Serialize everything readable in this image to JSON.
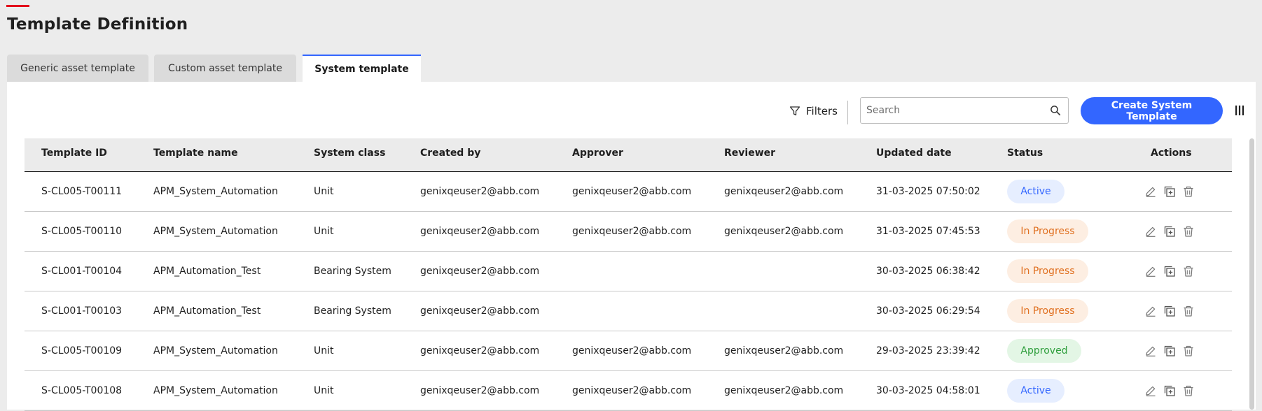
{
  "page": {
    "title": "Template Definition"
  },
  "tabs": [
    {
      "label": "Generic asset template",
      "active": false
    },
    {
      "label": "Custom asset template",
      "active": false
    },
    {
      "label": "System template",
      "active": true
    }
  ],
  "toolbar": {
    "filters_label": "Filters",
    "search_placeholder": "Search",
    "create_label": "Create System Template"
  },
  "table": {
    "headers": {
      "id": "Template ID",
      "name": "Template name",
      "system_class": "System class",
      "created_by": "Created by",
      "approver": "Approver",
      "reviewer": "Reviewer",
      "updated": "Updated date",
      "status": "Status",
      "actions": "Actions"
    },
    "rows": [
      {
        "id": "S-CL005-T00111",
        "name": "APM_System_Automation",
        "system_class": "Unit",
        "created_by": "genixqeuser2@abb.com",
        "approver": "genixqeuser2@abb.com",
        "reviewer": "genixqeuser2@abb.com",
        "updated": "31-03-2025 07:50:02",
        "status": "Active"
      },
      {
        "id": "S-CL005-T00110",
        "name": "APM_System_Automation",
        "system_class": "Unit",
        "created_by": "genixqeuser2@abb.com",
        "approver": "genixqeuser2@abb.com",
        "reviewer": "genixqeuser2@abb.com",
        "updated": "31-03-2025 07:45:53",
        "status": "In Progress"
      },
      {
        "id": "S-CL001-T00104",
        "name": "APM_Automation_Test",
        "system_class": "Bearing System",
        "created_by": "genixqeuser2@abb.com",
        "approver": "",
        "reviewer": "",
        "updated": "30-03-2025 06:38:42",
        "status": "In Progress"
      },
      {
        "id": "S-CL001-T00103",
        "name": "APM_Automation_Test",
        "system_class": "Bearing System",
        "created_by": "genixqeuser2@abb.com",
        "approver": "",
        "reviewer": "",
        "updated": "30-03-2025 06:29:54",
        "status": "In Progress"
      },
      {
        "id": "S-CL005-T00109",
        "name": "APM_System_Automation",
        "system_class": "Unit",
        "created_by": "genixqeuser2@abb.com",
        "approver": "genixqeuser2@abb.com",
        "reviewer": "genixqeuser2@abb.com",
        "updated": "29-03-2025 23:39:42",
        "status": "Approved"
      },
      {
        "id": "S-CL005-T00108",
        "name": "APM_System_Automation",
        "system_class": "Unit",
        "created_by": "genixqeuser2@abb.com",
        "approver": "genixqeuser2@abb.com",
        "reviewer": "genixqeuser2@abb.com",
        "updated": "30-03-2025 04:58:01",
        "status": "Active"
      }
    ]
  },
  "colors": {
    "brand_accent": "#e3001b",
    "primary_blue": "#3366ff",
    "status_active": "#3366ff",
    "status_in_progress": "#e07020",
    "status_approved": "#2e9e3c"
  },
  "icons": {
    "filter": "filter-icon",
    "search": "search-icon",
    "columns": "columns-icon",
    "edit": "edit-icon",
    "copy": "copy-icon",
    "delete": "trash-icon"
  }
}
